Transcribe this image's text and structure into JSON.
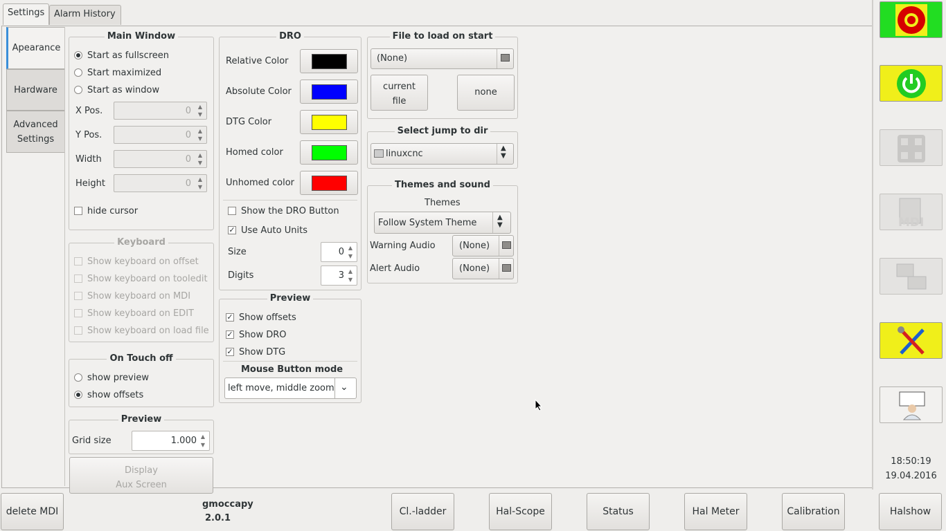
{
  "tabs": [
    "Settings",
    "Alarm History"
  ],
  "side_tabs": [
    "Apearance",
    "Hardware",
    "Advanced",
    "Settings"
  ],
  "main_window": {
    "title": "Main Window",
    "options": [
      "Start as fullscreen",
      "Start maximized",
      "Start as window"
    ],
    "fields": [
      {
        "label": "X Pos.",
        "value": "0"
      },
      {
        "label": "Y Pos.",
        "value": "0"
      },
      {
        "label": "Width",
        "value": "0"
      },
      {
        "label": "Height",
        "value": "0"
      }
    ],
    "hide_cursor": "hide cursor"
  },
  "keyboard": {
    "title": "Keyboard",
    "options": [
      "Show keyboard on offset",
      "Show keyboard on tooledit",
      "Show keyboard on MDI",
      "Show keyboard on EDIT",
      "Show keyboard on load file"
    ]
  },
  "touch_off": {
    "title": "On Touch off",
    "options": [
      "show preview",
      "show offsets"
    ]
  },
  "preview_left": {
    "title": "Preview",
    "grid_label": "Grid size",
    "grid_value": "1.000",
    "display_btn_1": "Display",
    "display_btn_2": "Aux Screen"
  },
  "dro": {
    "title": "DRO",
    "colors": [
      {
        "label": "Relative Color",
        "color": "#000000"
      },
      {
        "label": "Absolute Color",
        "color": "#0000ff"
      },
      {
        "label": "DTG Color",
        "color": "#ffff00"
      },
      {
        "label": "Homed color",
        "color": "#00ff00"
      },
      {
        "label": "Unhomed color",
        "color": "#ff0000"
      }
    ],
    "show_dro_button": "Show the DRO Button",
    "auto_units": "Use Auto Units",
    "size_label": "Size",
    "size_value": "0",
    "digits_label": "Digits",
    "digits_value": "3"
  },
  "preview_mid": {
    "title": "Preview",
    "options": [
      "Show offsets",
      "Show DRO",
      "Show DTG"
    ],
    "mouse_title": "Mouse Button mode",
    "mouse_value": "left move,  middle zoom"
  },
  "file_load": {
    "title": "File to load on start",
    "value": "(None)",
    "current_1": "current",
    "current_2": "file",
    "none": "none"
  },
  "jump_dir": {
    "title": "Select jump to dir",
    "value": "linuxcnc"
  },
  "themes": {
    "title": "Themes and sound",
    "themes_label": "Themes",
    "theme_value": "Follow System Theme",
    "warning_label": "Warning Audio",
    "warning_value": "(None)",
    "alert_label": "Alert Audio",
    "alert_value": "(None)"
  },
  "clock": {
    "time": "18:50:19",
    "date": "19.04.2016"
  },
  "app": {
    "name": "gmoccapy",
    "version": "2.0.1"
  },
  "bottom_buttons": [
    "delete MDI",
    "Cl.-ladder",
    "Hal-Scope",
    "Status",
    "Hal Meter",
    "Calibration",
    "Halshow"
  ],
  "side_icons": [
    "emergency-stop-icon",
    "power-icon",
    "jog-icon",
    "mdi-icon",
    "auto-icon",
    "settings-tools-icon",
    "user-tabs-icon"
  ],
  "colors": {
    "estop_bg": "#22dd22",
    "yellow_bg": "#f0ef1a",
    "accent": "#3a8fd9"
  }
}
